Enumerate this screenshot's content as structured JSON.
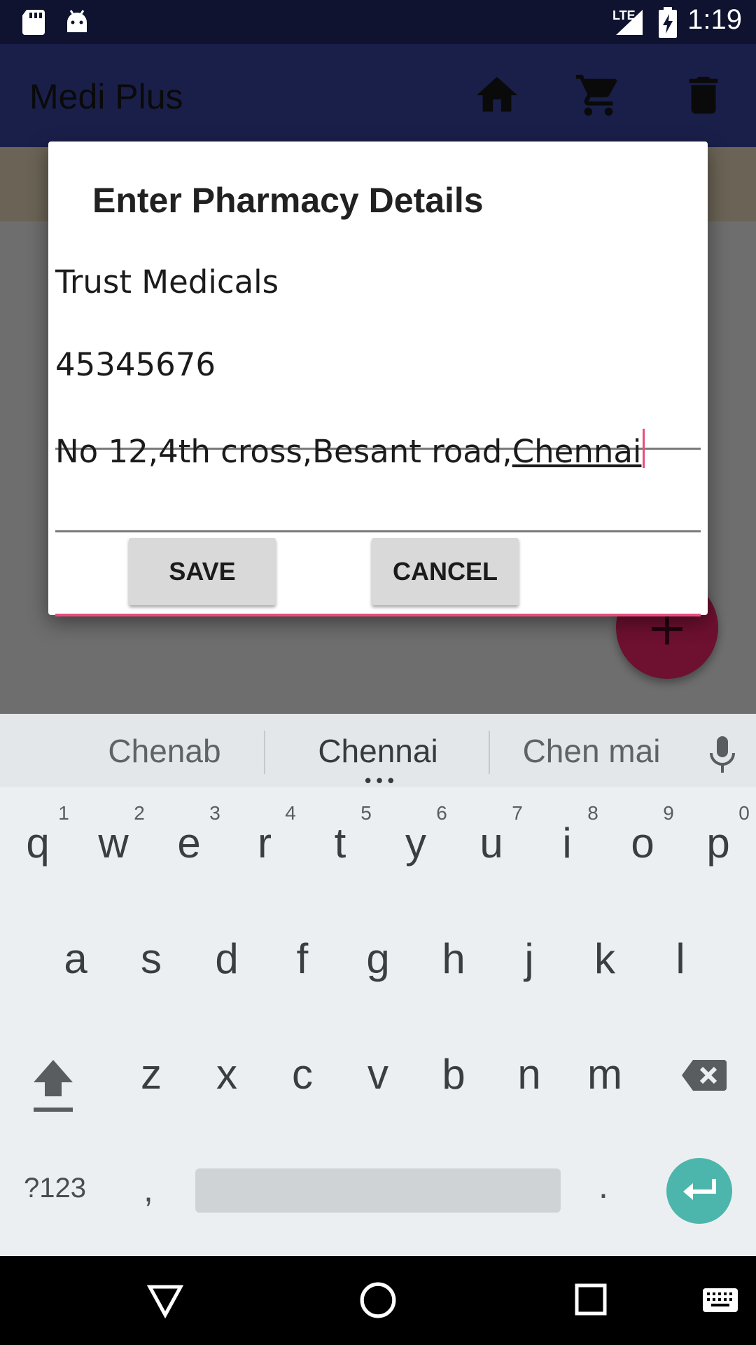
{
  "status_bar": {
    "time": "1:19",
    "network_label": "LTE",
    "icons": [
      "sd-card-icon",
      "android-debug-icon",
      "signal-icon",
      "battery-charging-icon"
    ]
  },
  "app_bar": {
    "title": "Medi Plus",
    "icons": [
      "home-icon",
      "cart-icon",
      "delete-icon"
    ]
  },
  "dialog": {
    "title": "Enter Pharmacy Details",
    "fields": [
      {
        "name": "pharmacy-name-field",
        "value": "Trust Medicals"
      },
      {
        "name": "phone-field",
        "value": "45345676"
      },
      {
        "name": "address-field",
        "value_prefix": "No 12,4th cross,Besant road,",
        "value_composing": "Chennai",
        "focused": true
      }
    ],
    "save_label": "SAVE",
    "cancel_label": "CANCEL",
    "accent_color": "#e84d7e"
  },
  "fab": {
    "icon": "plus-icon",
    "label": "+"
  },
  "keyboard": {
    "suggestions": [
      "Chenab",
      "Chennai",
      "Chen mai"
    ],
    "suggestion_more": "•••",
    "row1": [
      "q",
      "w",
      "e",
      "r",
      "t",
      "y",
      "u",
      "i",
      "o",
      "p"
    ],
    "row1_hints": [
      "1",
      "2",
      "3",
      "4",
      "5",
      "6",
      "7",
      "8",
      "9",
      "0"
    ],
    "row2": [
      "a",
      "s",
      "d",
      "f",
      "g",
      "h",
      "j",
      "k",
      "l"
    ],
    "row3": [
      "z",
      "x",
      "c",
      "v",
      "b",
      "n",
      "m"
    ],
    "symbols_label": "?123",
    "comma_label": ",",
    "period_label": ".",
    "enter_color": "#4db6ac"
  },
  "nav_bar": {
    "icons": [
      "back-icon",
      "home-circle-icon",
      "recents-icon",
      "keyboard-icon"
    ]
  }
}
